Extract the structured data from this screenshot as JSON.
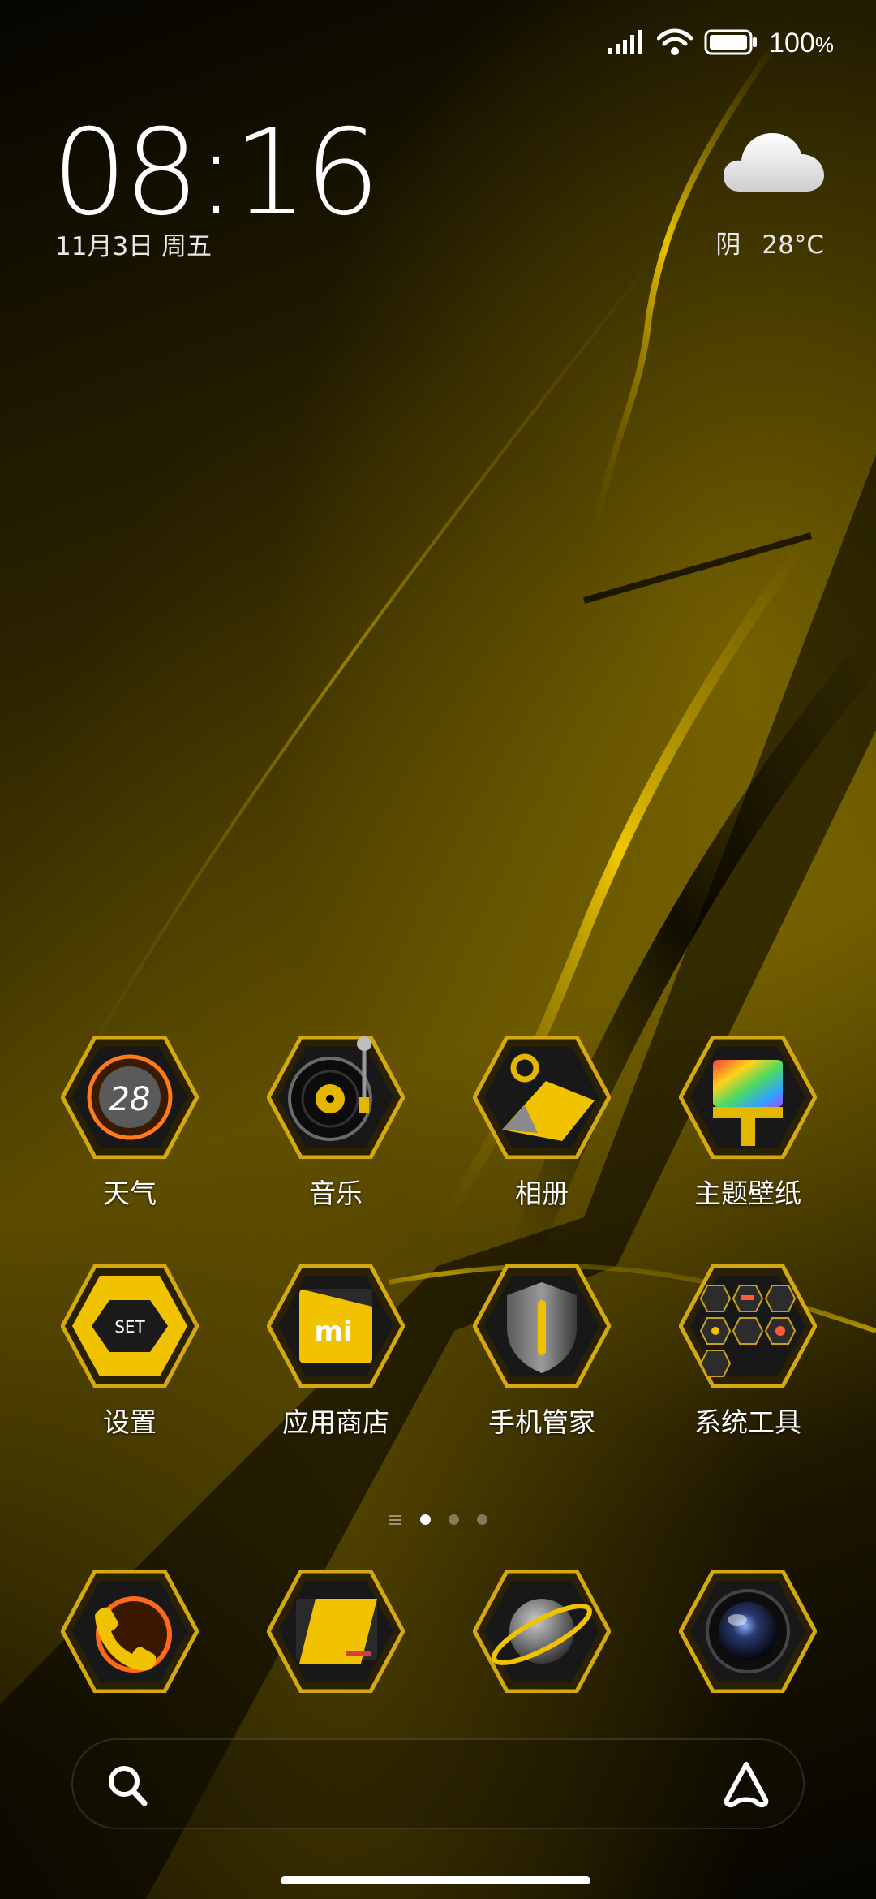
{
  "status_bar": {
    "battery_level": "100",
    "battery_unit": "%"
  },
  "clock": {
    "time": "08:16",
    "date": "11月3日 周五"
  },
  "weather": {
    "condition": "阴",
    "temperature": "28°C",
    "icon": "cloud-icon"
  },
  "apps": [
    {
      "label": "天气",
      "icon": "weather-app-icon"
    },
    {
      "label": "音乐",
      "icon": "music-app-icon"
    },
    {
      "label": "相册",
      "icon": "gallery-app-icon"
    },
    {
      "label": "主题壁纸",
      "icon": "themes-app-icon"
    },
    {
      "label": "设置",
      "icon": "settings-app-icon"
    },
    {
      "label": "应用商店",
      "icon": "app-store-icon"
    },
    {
      "label": "手机管家",
      "icon": "security-app-icon"
    },
    {
      "label": "系统工具",
      "icon": "system-tools-folder-icon"
    }
  ],
  "weather_icon_text": "28",
  "settings_icon_text": "SET",
  "store_icon_text": "mi",
  "page_indicator": {
    "pages": 3,
    "active": 1
  },
  "dock": [
    {
      "icon": "phone-app-icon"
    },
    {
      "icon": "messages-app-icon"
    },
    {
      "icon": "browser-app-icon"
    },
    {
      "icon": "camera-app-icon"
    }
  ],
  "colors": {
    "accent_gold": "#e3b600",
    "hex_frame": "#b8900a",
    "hex_inner": "#141414"
  }
}
